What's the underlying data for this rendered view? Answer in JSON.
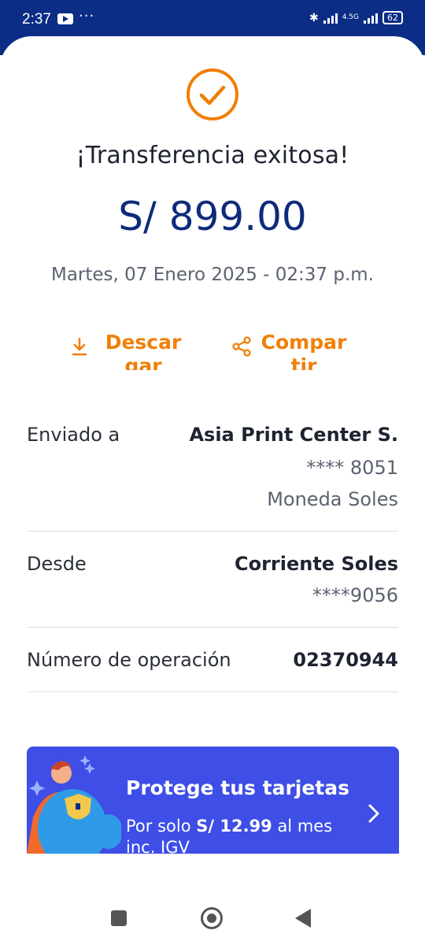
{
  "status_bar": {
    "time": "2:37",
    "dots": "···",
    "network": "4.5G",
    "battery": "62"
  },
  "receipt": {
    "title": "¡Transferencia exitosa!",
    "amount": "S/ 899.00",
    "datetime": "Martes, 07 Enero 2025 - 02:37 p.m.",
    "download_label": "Descargar",
    "share_label": "Compartir",
    "accent_color": "#f07f09",
    "brand_color": "#0d2b7a"
  },
  "details": {
    "sent_to_label": "Enviado a",
    "sent_to_name": "Asia Print Center S.",
    "sent_to_account": "**** 8051",
    "sent_to_currency": "Moneda Soles",
    "from_label": "Desde",
    "from_account_name": "Corriente Soles",
    "from_account_number": "****9056",
    "operation_label": "Número de operación",
    "operation_number": "02370944"
  },
  "promo": {
    "title": "Protege tus tarjetas",
    "sub_prefix": "Por solo ",
    "sub_price": "S/ 12.99",
    "sub_suffix": " al mes inc. IGV",
    "color": "#3e4ee6"
  },
  "icons": {
    "success": "check-circle-icon",
    "download": "download-icon",
    "share": "share-icon",
    "promo_arrow": "chevron-right-icon"
  }
}
